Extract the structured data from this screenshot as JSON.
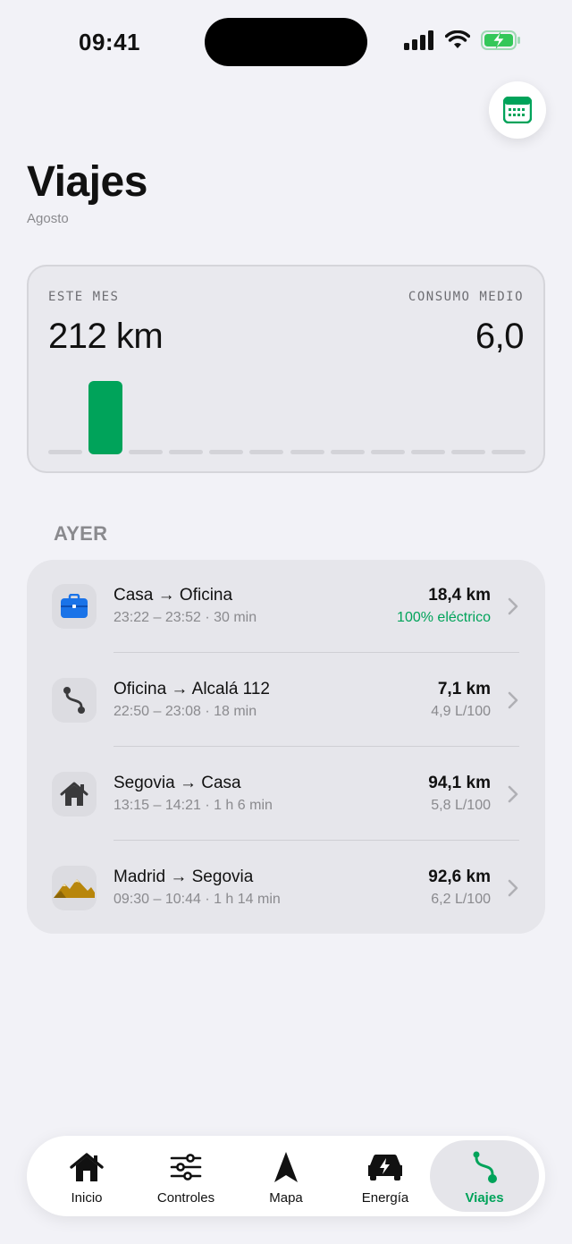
{
  "status_bar": {
    "time": "09:41"
  },
  "header": {
    "title": "Viajes",
    "subtitle": "Agosto"
  },
  "summary": {
    "left_label": "ESTE MES",
    "left_value": "212 km",
    "right_label": "CONSUMO MEDIO",
    "right_value": "6,0",
    "bars": [
      0,
      1,
      0,
      0,
      0,
      0,
      0,
      0,
      0,
      0,
      0,
      0
    ],
    "bar_color": "#00a35a"
  },
  "section": {
    "title": "AYER"
  },
  "trips": [
    {
      "icon": "briefcase-icon",
      "route": "Casa → Oficina",
      "times": "23:22 – 23:52 · 30 min",
      "km": "18,4 km",
      "consumo": "100% eléctrico",
      "consumo_accent": true
    },
    {
      "icon": "route-icon",
      "route": "Oficina → Alcalá 112",
      "times": "22:50 – 23:08 · 18 min",
      "km": "7,1 km",
      "consumo": "4,9 L/100",
      "consumo_accent": false
    },
    {
      "icon": "house-icon",
      "route": "Segovia → Casa",
      "times": "13:15 – 14:21 · 1 h 6 min",
      "km": "94,1 km",
      "consumo": "5,8 L/100",
      "consumo_accent": false
    },
    {
      "icon": "mountains-icon",
      "route": "Madrid → Segovia",
      "times": "09:30 – 10:44 · 1 h 14 min",
      "km": "92,6 km",
      "consumo": "6,2 L/100",
      "consumo_accent": false
    }
  ],
  "tabs": [
    {
      "label": "Inicio",
      "icon": "house-icon",
      "active": false
    },
    {
      "label": "Controles",
      "icon": "sliders-icon",
      "active": false
    },
    {
      "label": "Mapa",
      "icon": "navigation-arrow-icon",
      "active": false
    },
    {
      "label": "Energía",
      "icon": "car-bolt-icon",
      "active": false
    },
    {
      "label": "Viajes",
      "icon": "route-icon",
      "active": true
    }
  ],
  "colors": {
    "accent": "#00a35a",
    "background": "#f2f2f7",
    "briefcase": "#1a73e8",
    "mountains": "#b8860b"
  }
}
